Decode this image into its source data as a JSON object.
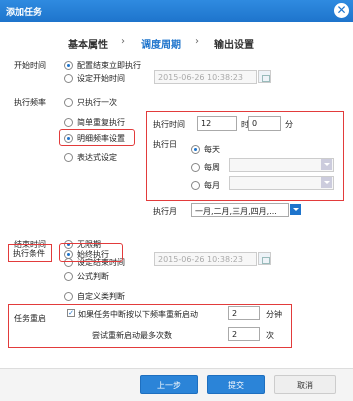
{
  "dialog": {
    "title": "添加任务",
    "close_glyph": "✕"
  },
  "steps": [
    {
      "label": "基本属性",
      "active": false
    },
    {
      "label": "调度周期",
      "active": true
    },
    {
      "label": "输出设置",
      "active": false
    }
  ],
  "step_arrow": "›",
  "start_time": {
    "label": "开始时间",
    "options": [
      "配置结束立即执行",
      "设定开始时间"
    ],
    "selected": 0,
    "datetime": "2015-06-26 10:38:23"
  },
  "exec_freq": {
    "label": "执行频率",
    "options": [
      "只执行一次",
      "简单重复执行",
      "明细频率设置",
      "表达式设定"
    ],
    "selected": 2
  },
  "detail": {
    "time_label": "执行时间",
    "hour_value": "12",
    "hour_unit": "时",
    "minute_value": "0",
    "minute_unit": "分",
    "day_label": "执行日",
    "day_options": [
      "每天",
      "每周",
      "每月"
    ],
    "day_selected": 0,
    "month_label": "执行月",
    "month_value": "一月,二月,三月,四月,..."
  },
  "end_time": {
    "label": "结束时间",
    "options": [
      "无限期",
      "设定结束时间"
    ],
    "selected": 0,
    "datetime": "2015-06-26 10:38:23"
  },
  "exec_cond": {
    "label": "执行条件",
    "options": [
      "始终执行",
      "公式判断",
      "自定义类判断"
    ],
    "selected": 0
  },
  "restart": {
    "label": "任务重启",
    "checkbox_label": "如果任务中断按以下频率重新启动",
    "checked": true,
    "check_glyph": "✓",
    "interval_value": "2",
    "interval_unit": "分钟",
    "retry_label": "尝试重新启动最多次数",
    "retry_value": "2",
    "retry_unit": "次"
  },
  "buttons": {
    "prev": "上一步",
    "submit": "提交",
    "cancel": "取消"
  }
}
